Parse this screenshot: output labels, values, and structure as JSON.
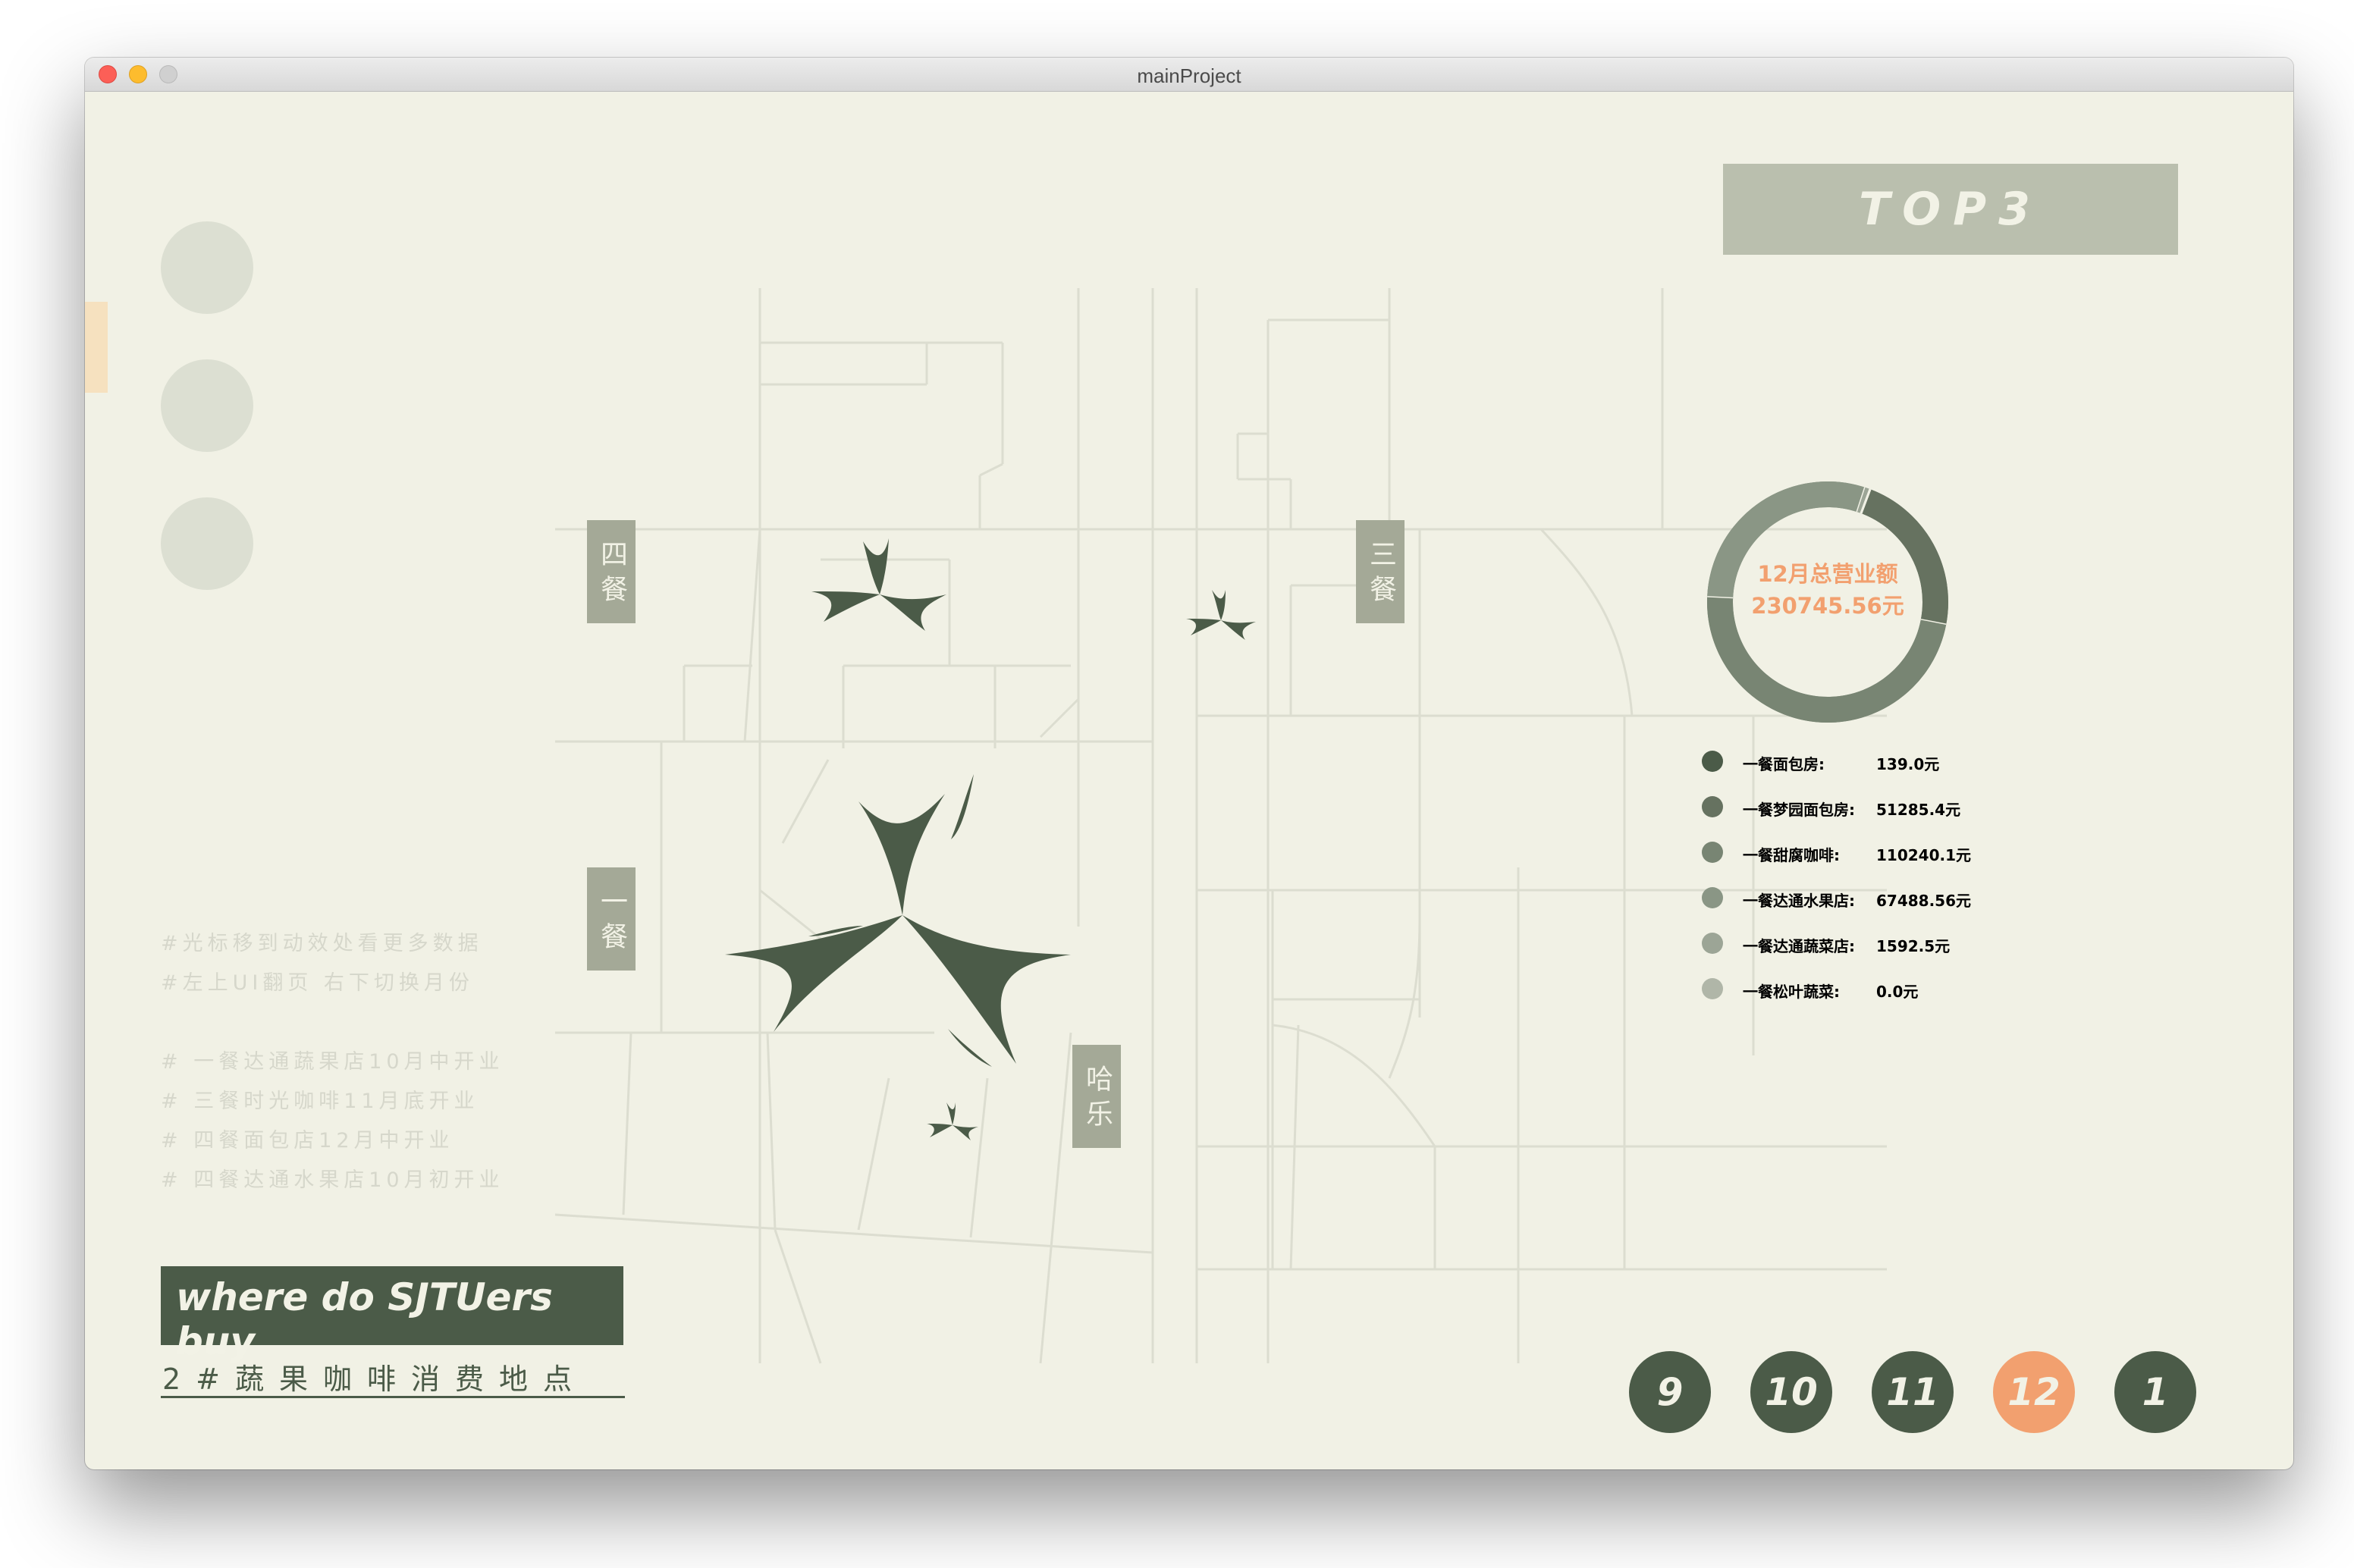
{
  "window": {
    "title": "mainProject"
  },
  "nav": {
    "dots": [
      "",
      "",
      ""
    ]
  },
  "map_labels": {
    "siCan": "四餐",
    "sanCan": "三餐",
    "yiCan": "一餐",
    "haLe": "哈乐"
  },
  "notes": [
    "#光标移到动效处看更多数据",
    "#左上UI翻页 右下切换月份",
    "",
    "# 一餐达通蔬果店10月中开业",
    "# 三餐时光咖啡11月底开业",
    "# 四餐面包店12月中开业",
    "# 四餐达通水果店10月初开业"
  ],
  "brand": {
    "title": "where do SJTUers buy",
    "subtitle": "2#蔬果咖啡消费地点"
  },
  "top3": {
    "label": "TOP3"
  },
  "donut": {
    "title": "12月总营业额",
    "total": "230745.56元"
  },
  "chart_data": {
    "type": "pie",
    "title": "12月总营业额",
    "total": 230745.56,
    "categories": [
      "一餐面包房",
      "一餐梦园面包房",
      "一餐甜腐咖啡",
      "一餐达通水果店",
      "一餐达通蔬菜店",
      "一餐松叶蔬菜"
    ],
    "values": [
      139.0,
      51285.4,
      110240.1,
      67488.56,
      1592.5,
      0.0
    ],
    "colors": [
      "#4b5b48",
      "#667260",
      "#788573",
      "#8a9685",
      "#9ca596",
      "#b0b6a8"
    ]
  },
  "legend": [
    {
      "name": "一餐面包房:",
      "value": "139.0元",
      "color": "#4b5b48"
    },
    {
      "name": "一餐梦园面包房:",
      "value": "51285.4元",
      "color": "#667260"
    },
    {
      "name": "一餐甜腐咖啡:",
      "value": "110240.1元",
      "color": "#788573"
    },
    {
      "name": "一餐达通水果店:",
      "value": "67488.56元",
      "color": "#8a9685"
    },
    {
      "name": "一餐达通蔬菜店:",
      "value": "1592.5元",
      "color": "#9ca596"
    },
    {
      "name": "一餐松叶蔬菜:",
      "value": "0.0元",
      "color": "#b0b6a8"
    }
  ],
  "months": [
    {
      "label": "9",
      "active": false
    },
    {
      "label": "10",
      "active": false
    },
    {
      "label": "11",
      "active": false
    },
    {
      "label": "12",
      "active": true
    },
    {
      "label": "1",
      "active": false
    }
  ],
  "colors": {
    "background": "#f1f1e5",
    "dark": "#4b5b48",
    "accent": "#f2a06f",
    "label_bg": "#a4a997"
  }
}
